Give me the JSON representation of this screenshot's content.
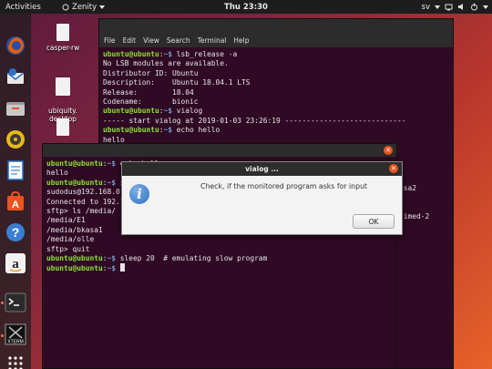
{
  "topbar": {
    "activities": "Activities",
    "app_name": "Zenity",
    "clock": "Thu 23:30",
    "keyboard_layout": "sv"
  },
  "dock": {
    "items": [
      {
        "name": "firefox-icon",
        "color": "#e66000",
        "running": false
      },
      {
        "name": "thunderbird-icon",
        "color": "#2d6fc4",
        "running": false
      },
      {
        "name": "files-icon",
        "color": "#8c8c8c",
        "running": false
      },
      {
        "name": "rhythmbox-icon",
        "color": "#e8b818",
        "running": false
      },
      {
        "name": "libreoffice-writer-icon",
        "color": "#1f6fc5",
        "running": false
      },
      {
        "name": "software-center-icon",
        "color": "#e95420",
        "running": false
      },
      {
        "name": "help-icon",
        "color": "#3b7fd4",
        "running": false
      },
      {
        "name": "amazon-icon",
        "color": "#f2f2f2",
        "running": false
      },
      {
        "name": "terminal-icon",
        "color": "#2b2b2b",
        "running": true
      },
      {
        "name": "xterm-icon",
        "color": "#111111",
        "running": true
      },
      {
        "name": "show-apps-icon",
        "color": "transparent",
        "running": false
      }
    ],
    "xterm_label": "XTERM"
  },
  "desktop": {
    "icons": [
      {
        "label": "casper-rw"
      },
      {
        "label": "ubiquity.\ndesktop"
      },
      {
        "label": ""
      }
    ]
  },
  "terminal_back": {
    "menu": [
      "File",
      "Edit",
      "View",
      "Search",
      "Terminal",
      "Help"
    ],
    "lines": [
      {
        "prompt": true,
        "cmd": " lsb_release -a"
      },
      {
        "text": "No LSB modules are available."
      },
      {
        "text": "Distributor ID: Ubuntu"
      },
      {
        "text": "Description:    Ubuntu 18.04.1 LTS"
      },
      {
        "text": "Release:        18.04"
      },
      {
        "text": "Codename:       bionic"
      },
      {
        "prompt": true,
        "cmd": " vialog"
      },
      {
        "text": "----- start vialog at 2019-01-03 23:26:19 ----------------------------"
      },
      {
        "prompt": true,
        "cmd": " echo hello"
      },
      {
        "text": "hello"
      },
      {
        "prompt": true,
        "cmd": " sftp sudodus@192.168.0.4"
      }
    ],
    "partial_right": [
      "asa2",
      "timed-2"
    ]
  },
  "terminal_front": {
    "lines": [
      {
        "prompt": true,
        "cmd": " echo hello"
      },
      {
        "text": "hello"
      },
      {
        "prompt": true,
        "cmd": " s"
      },
      {
        "text": "sudodus@192.168.0."
      },
      {
        "text": "Connected to 192.1"
      },
      {
        "text": "sftp> ls /media/"
      },
      {
        "text": "/media/E1"
      },
      {
        "text": "/media/bkasa1"
      },
      {
        "text": "/media/olle"
      },
      {
        "text": "sftp> quit"
      },
      {
        "prompt": true,
        "cmd": " sleep 20  # emulating slow program"
      },
      {
        "prompt": true,
        "cmd": " ",
        "cursor": true
      }
    ],
    "prompt_user": "ubuntu@ubuntu",
    "prompt_colon": ":",
    "prompt_path": "~$"
  },
  "dialog": {
    "title": "vialog  ...",
    "message": "Check, if the monitored program asks for input",
    "ok_label": "OK",
    "info_glyph": "i"
  }
}
